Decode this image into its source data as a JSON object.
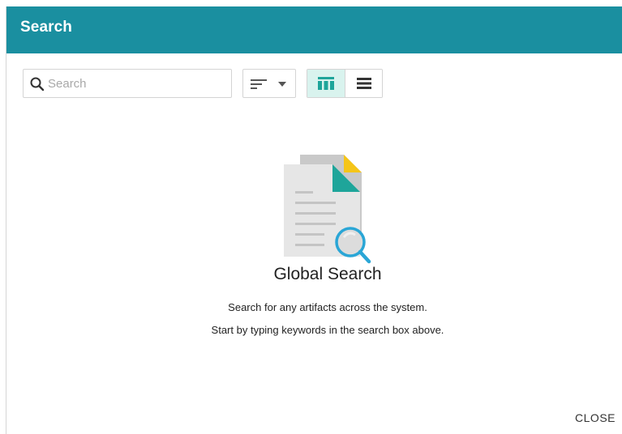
{
  "dialog": {
    "title": "Search",
    "close_label": "CLOSE"
  },
  "toolbar": {
    "search_placeholder": "Search",
    "search_value": "",
    "sort_icon": "sort-lines-icon",
    "view_options": [
      {
        "icon": "grid-view-icon",
        "selected": true
      },
      {
        "icon": "list-view-icon",
        "selected": false
      }
    ]
  },
  "empty_state": {
    "icon": "document-search-icon",
    "title": "Global Search",
    "line1": "Search for any artifacts across the system.",
    "line2": "Start by typing keywords in the search box above."
  },
  "colors": {
    "header": "#1a8fa0",
    "accent": "#1ea59a",
    "selected_toggle_bg": "#d9f3ee",
    "magnifier": "#2aa6d6",
    "doc_corner": "#f5c518"
  }
}
